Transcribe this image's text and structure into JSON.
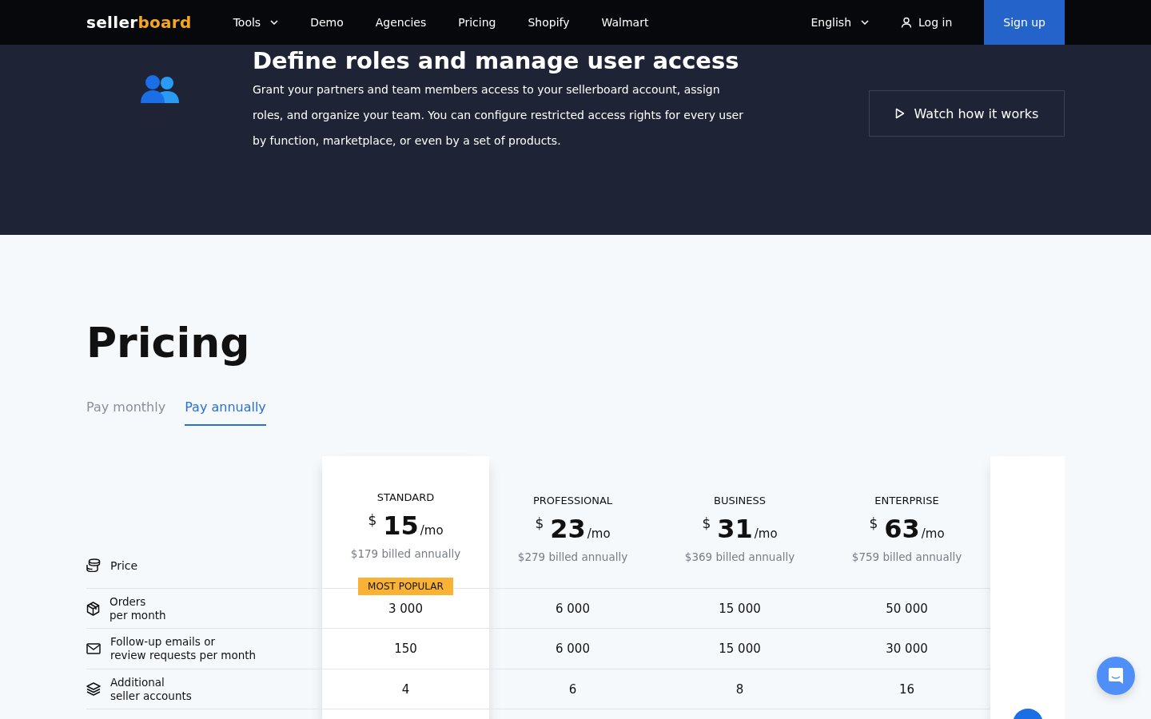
{
  "nav": {
    "logo": [
      "seller",
      "board"
    ],
    "items": [
      {
        "label": "Tools",
        "kind": "dropdown"
      },
      {
        "label": "Demo",
        "kind": "link"
      },
      {
        "label": "Agencies",
        "kind": "link"
      },
      {
        "label": "Pricing",
        "kind": "link"
      },
      {
        "label": "Shopify",
        "kind": "link"
      },
      {
        "label": "Walmart",
        "kind": "link"
      }
    ],
    "language": "English",
    "login": "Log in",
    "signup": "Sign up"
  },
  "hero": {
    "title": "Define roles and manage user access",
    "text": "Grant your partners and team members access to your sellerboard account, assign roles, and organize your team. You can configure restricted access rights for every user by function, marketplace, or even by a set of products.",
    "button": "Watch how it works"
  },
  "pricing": {
    "title": "Pricing",
    "tabs": [
      {
        "label": "Pay monthly",
        "selected": false
      },
      {
        "label": "Pay annually",
        "selected": true
      }
    ],
    "price_label": "Price",
    "plans": [
      {
        "name": "STANDARD",
        "currency": "$",
        "amount": "15",
        "period": "/mo",
        "billed": "$179 billed annually",
        "highlighted": true,
        "badge": "MOST POPULAR"
      },
      {
        "name": "PROFESSIONAL",
        "currency": "$",
        "amount": "23",
        "period": "/mo",
        "billed": "$279 billed annually",
        "highlighted": false
      },
      {
        "name": "BUSINESS",
        "currency": "$",
        "amount": "31",
        "period": "/mo",
        "billed": "$369 billed annually",
        "highlighted": false
      },
      {
        "name": "ENTERPRISE",
        "currency": "$",
        "amount": "63",
        "period": "/mo",
        "billed": "$759 billed annually",
        "highlighted": false
      }
    ],
    "features": [
      {
        "label": "Orders\nper month",
        "values": [
          "3 000",
          "6 000",
          "15 000",
          "50 000"
        ]
      },
      {
        "label": "Follow-up emails or\nreview requests per month",
        "values": [
          "150",
          "6 000",
          "15 000",
          "30 000"
        ]
      },
      {
        "label": "Additional\nseller accounts",
        "values": [
          "4",
          "6",
          "8",
          "16"
        ]
      }
    ]
  }
}
